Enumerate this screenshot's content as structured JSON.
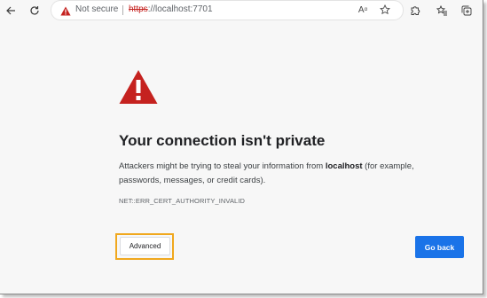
{
  "browser": {
    "security_label": "Not secure",
    "url_scheme": "https",
    "url_rest": "://localhost:7701",
    "read_aloud_glyph": "A",
    "read_aloud_sup": "α",
    "icons": {
      "back": "arrow-left-icon",
      "reload": "refresh-icon",
      "warning": "warning-triangle-icon",
      "favorite": "star-outline-icon",
      "extensions": "puzzle-icon",
      "favorites": "star-list-icon",
      "collections": "collections-icon"
    }
  },
  "page": {
    "title": "Your connection isn't private",
    "desc_prefix": "Attackers might be trying to steal your information from ",
    "desc_host": "localhost",
    "desc_suffix": " (for example, passwords, messages, or credit cards).",
    "error_code": "NET::ERR_CERT_AUTHORITY_INVALID",
    "advanced_label": "Advanced",
    "go_back_label": "Go back"
  },
  "colors": {
    "warning_red": "#c5221f",
    "highlight": "#f0a81e",
    "primary_button": "#1a73e8"
  }
}
